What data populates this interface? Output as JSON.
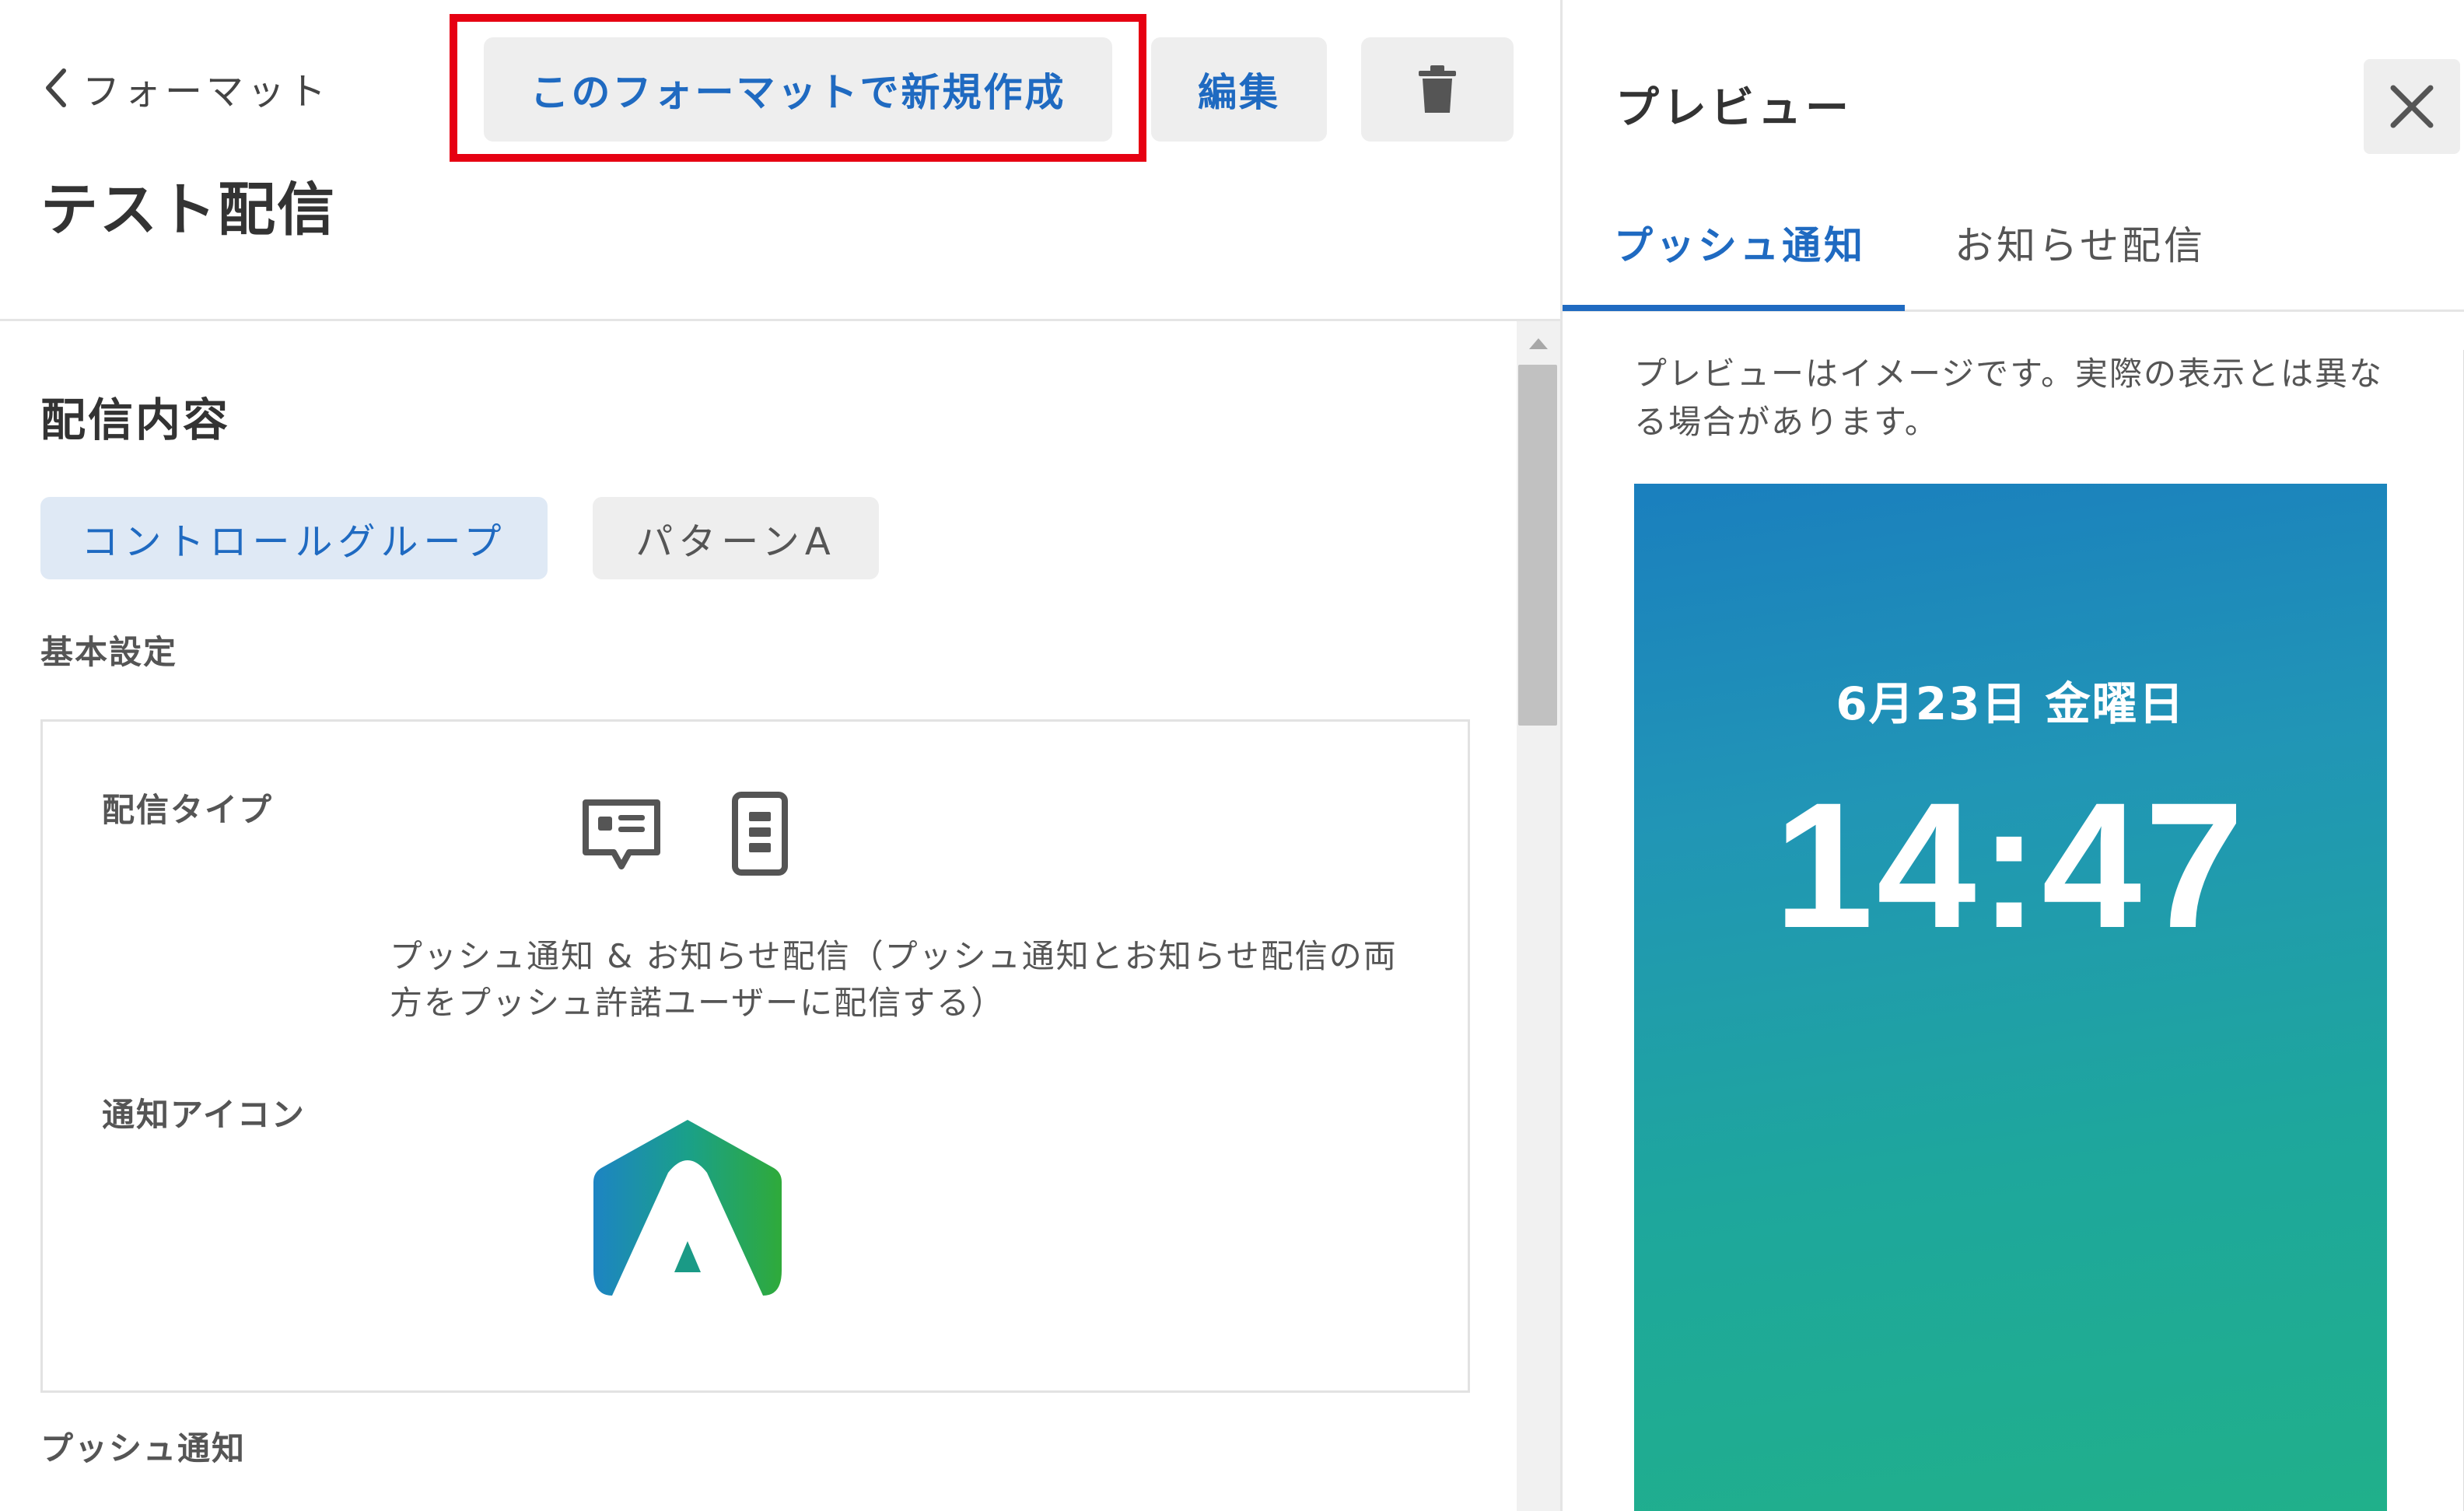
{
  "header": {
    "back_label": "フォーマット",
    "page_title": "テスト配信",
    "new_button_label": "このフォーマットで新規作成",
    "edit_button_label": "編集"
  },
  "content": {
    "section_title": "配信内容",
    "patterns": [
      {
        "label": "コントロールグループ",
        "active": true
      },
      {
        "label": "パターンA",
        "active": false
      }
    ],
    "basic_settings_label": "基本設定",
    "delivery_type_label": "配信タイプ",
    "delivery_type_description": "プッシュ通知 & お知らせ配信（プッシュ通知とお知らせ配信の両方をプッシュ許諾ユーザーに配信する）",
    "notification_icon_label": "通知アイコン",
    "push_section_label": "プッシュ通知"
  },
  "preview": {
    "title": "プレビュー",
    "tabs": [
      {
        "label": "プッシュ通知",
        "active": true
      },
      {
        "label": "お知らせ配信",
        "active": false
      }
    ],
    "note": "プレビューはイメージです。実際の表示とは異なる場合があります。",
    "lock_screen_date": "6月23日 金曜日",
    "lock_screen_time": "14:47"
  },
  "colors": {
    "accent": "#1f6ac1",
    "highlight": "#e60012",
    "pill_active_bg": "#dfe9f5",
    "gradient_top": "#1a7fbe",
    "gradient_bottom": "#20b08a"
  },
  "icons": {
    "back": "chevron-left-icon",
    "delete": "trash-icon",
    "close": "close-icon",
    "push_type": "message-bubble-icon",
    "news_type": "smartphone-icon",
    "app": "app-logo-icon"
  }
}
